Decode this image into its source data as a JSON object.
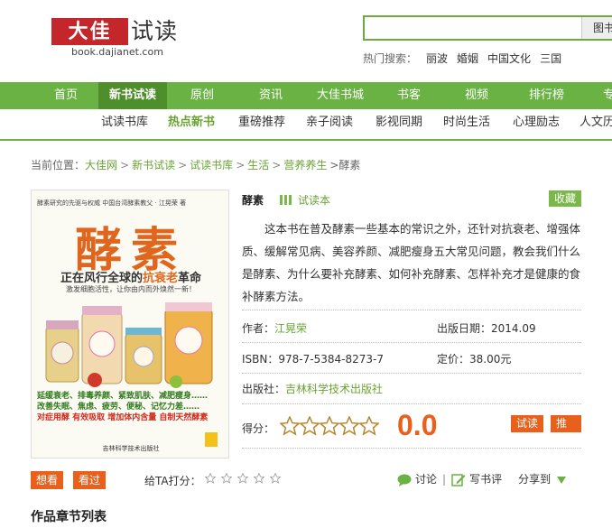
{
  "header": {
    "logo_red": "大佳",
    "logo_dark": "试读",
    "logo_domain": "book.dajianet.com",
    "search_placeholder": "",
    "search_button": "图书",
    "hot_label": "热门搜索：",
    "hot_words": [
      "丽波",
      "婚姻",
      "中国文化",
      "三国"
    ]
  },
  "mainnav": [
    "首页",
    "新书试读",
    "原创",
    "资讯",
    "大佳书城",
    "书客",
    "视频",
    "排行榜",
    "专"
  ],
  "subnav": [
    "试读书库",
    "热点新书",
    "重磅推荐",
    "亲子阅读",
    "影视同期",
    "时尚生活",
    "心理励志",
    "人文历"
  ],
  "breadcrumb": {
    "prefix": "当前位置：",
    "links": [
      "大佳网",
      "新书试读",
      "试读书库",
      "生活",
      "营养养生"
    ],
    "sep": ">",
    "current": ">酵素"
  },
  "cover": {
    "top_line": "酵素研究的先驱与权威  中国台湾酵素教父 · 江晃荣  著",
    "big_title": "酵素",
    "sub_prefix": "正在风行全球的",
    "sub_highlight": "抗衰老",
    "sub_suffix": "革命",
    "sub2": "激发细胞活性，让你由内而外焕然一新！",
    "blurb1": "延缓衰老、排毒养颜、紧致肌肤、减肥瘦身……",
    "blurb2": "改善失眠、焦虑、疲劳、便秘、记忆力差……",
    "blurb3": "对症用酵  有效吸取  增加体内含量  自制天然酵素",
    "publisher_small": "吉林科学技术出版社"
  },
  "book": {
    "title": "酵素",
    "trial_label": "试读本",
    "fav_button": "收藏",
    "description": "这本书在普及酵素一些基本的常识之外，还针对抗衰老、增强体质、缓解常见病、美容养颜、减肥瘦身五大常见问题，教会我们什么是酵素、为什么要补充酵素、如何补充酵素、怎样补充才是健康的食补酵素方法。",
    "author_label": "作者：",
    "author": "江晃荣",
    "date_label": "出版日期：",
    "date": "2014.09",
    "isbn_label": "ISBN：",
    "isbn": "978-7-5384-8273-7",
    "price_label": "定价：",
    "price": "38.00元",
    "publisher_label": "出版社：",
    "publisher": "吉林科学技术出版社",
    "rating_label": "得分：",
    "score": "0.0",
    "star_count": 5,
    "stars_filled": 0,
    "read_button": "试读",
    "recommend_button": "推荐"
  },
  "actions": {
    "want_button": "想看",
    "read_button": "看过",
    "give_score": "给TA打分：",
    "comment": "讨论",
    "divider": "|",
    "write_review": "写书评",
    "share": "分享到"
  },
  "chapters_title": "作品章节列表",
  "colors": {
    "green": "#6bb244",
    "dark_green": "#4e8f2c",
    "orange": "#e8601c",
    "red": "#c3272b"
  }
}
